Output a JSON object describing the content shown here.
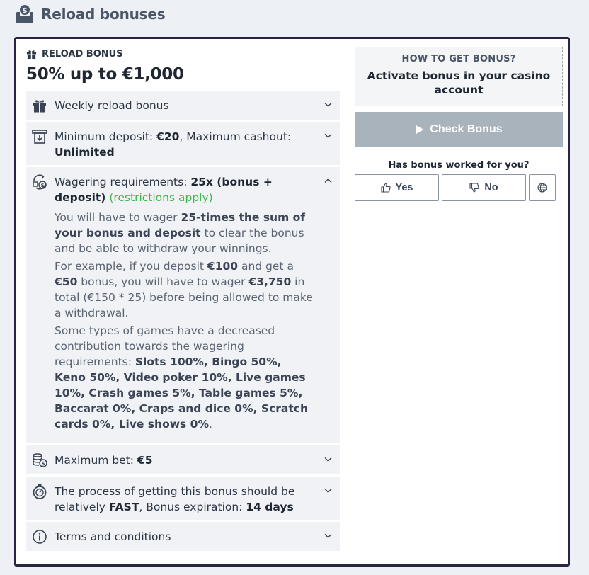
{
  "header": {
    "title": "Reload bonuses",
    "icon": "bonus-box-icon"
  },
  "bonus": {
    "label": "RELOAD BONUS",
    "title": "50% up to €1,000"
  },
  "rows": {
    "weekly": {
      "text": "Weekly reload bonus",
      "icon": "gift-icon"
    },
    "deposit": {
      "icon": "deposit-icon",
      "t1": "Minimum deposit: ",
      "v1": "€20",
      "t2": ", Maximum cashout: ",
      "v2": "Unlimited"
    },
    "wagering": {
      "icon": "wagering-icon",
      "t1": "Wagering requirements: ",
      "v1": "25x (bonus + deposit)",
      "note": "(restrictions apply)",
      "p1a": "You will have to wager ",
      "p1b": "25-times the sum of your bonus and deposit",
      "p1c": " to clear the bonus and be able to withdraw your winnings.",
      "p2a": "For example, if you deposit ",
      "p2b": "€100",
      "p2c": " and get a ",
      "p2d": "€50",
      "p2e": " bonus, you will have to wager ",
      "p2f": "€3,750",
      "p2g": " in total (€150 * 25) before being allowed to make a withdrawal.",
      "p3a": "Some types of games have a decreased contribution towards the wagering requirements: ",
      "p3b": "Slots 100%, Bingo 50%, Keno 50%, Video poker 10%, Live games 10%, Crash games 5%, Table games 5%, Baccarat 0%, Craps and dice 0%, Scratch cards 0%, Live shows 0%",
      "p3c": "."
    },
    "maxbet": {
      "icon": "coins-icon",
      "t1": "Maximum bet: ",
      "v1": "€5"
    },
    "process": {
      "icon": "stopwatch-icon",
      "t1": "The process of getting this bonus should be relatively ",
      "v1": "FAST",
      "t2": ", Bonus expiration: ",
      "v2": "14 days"
    },
    "terms": {
      "icon": "info-icon",
      "text": "Terms and conditions"
    }
  },
  "sidebar": {
    "howto_label": "HOW TO GET BONUS?",
    "howto_text": "Activate bonus in your casino account",
    "check_button": "Check Bonus",
    "feedback_question": "Has bonus worked for you?",
    "yes": "Yes",
    "no": "No"
  },
  "colors": {
    "card_border": "#2c2342",
    "check_button_bg": "#a9b3bb",
    "note_green": "#3db84a"
  }
}
